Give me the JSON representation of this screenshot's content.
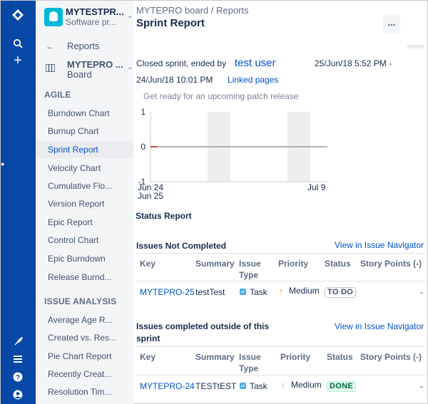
{
  "global_nav": {
    "icons": [
      "jira-logo-icon",
      "search-icon",
      "create-plus-icon",
      "feedback-rocket-icon",
      "menu-icon",
      "help-icon",
      "profile-icon"
    ]
  },
  "sidebar": {
    "project_name": "MYTESTPR...",
    "project_type": "Software pr...",
    "back_label": "Reports",
    "board_name": "MYTEPRO ...",
    "board_label": "Board",
    "agile_title": "AGILE",
    "agile_items": [
      {
        "label": "Burndown Chart"
      },
      {
        "label": "Burnup Chart"
      },
      {
        "label": "Sprint Report"
      },
      {
        "label": "Velocity Chart"
      },
      {
        "label": "Cumulative Flo..."
      },
      {
        "label": "Version Report"
      },
      {
        "label": "Epic Report"
      },
      {
        "label": "Control Chart"
      },
      {
        "label": "Epic Burndown"
      },
      {
        "label": "Release Burnd..."
      }
    ],
    "issue_title": "ISSUE ANALYSIS",
    "issue_items": [
      {
        "label": "Average Age R..."
      },
      {
        "label": "Created vs. Res..."
      },
      {
        "label": "Pie Chart Report"
      },
      {
        "label": "Recently Creat..."
      },
      {
        "label": "Resolution Tim..."
      }
    ]
  },
  "header": {
    "breadcrumb": "MYTEPRO board  /  Reports",
    "title": "Sprint Report",
    "more_label": "..."
  },
  "sprint": {
    "closed_text": "Closed sprint, ended by",
    "user": "test user",
    "start": "25/Jun/18 5:52 PM -",
    "end": "24/Jun/18 10:01 PM",
    "linked_pages": "Linked pages",
    "goal": "Get ready for an upcoming patch release"
  },
  "chart_data": {
    "type": "line",
    "y_ticks": [
      "1",
      "0",
      "-1"
    ],
    "ylim": [
      -1,
      1
    ],
    "x_ticks": [
      "Jun 24",
      "Jun 25",
      "Jul 9"
    ],
    "series": [
      {
        "values": [
          0,
          0
        ]
      }
    ],
    "colors": {
      "line": "#999999",
      "start": "#d04437",
      "weekend": "#eeeeee",
      "grid": "#cccccc"
    }
  },
  "status_report": {
    "title": "Status Report",
    "columns": [
      "Key",
      "Summary",
      "Issue Type",
      "Priority",
      "Status",
      "Story Points (-)"
    ],
    "not_completed": {
      "title": "Issues Not Completed",
      "link": "View in Issue Navigator",
      "rows": [
        {
          "key": "MYTEPRO-25",
          "summary": "testTest",
          "type": "Task",
          "priority": "Medium",
          "status": "TO DO",
          "points": "-"
        }
      ]
    },
    "completed_outside": {
      "title": "Issues completed outside of this sprint",
      "link": "View in Issue Navigator",
      "rows": [
        {
          "key": "MYTEPRO-24",
          "summary": "TESTtEST",
          "type": "Task",
          "priority": "Medium",
          "status": "DONE",
          "points": "-"
        }
      ]
    }
  }
}
